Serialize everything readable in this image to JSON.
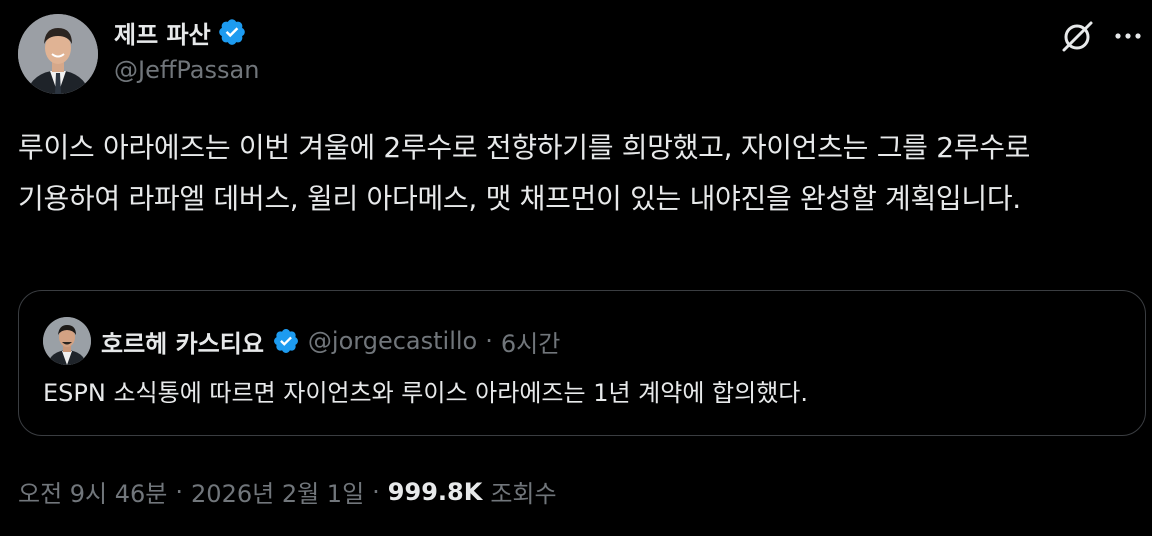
{
  "author": {
    "name": "제프 파산",
    "handle": "@JeffPassan",
    "verified": true
  },
  "tweet": {
    "text": "루이스 아라에즈는 이번 겨울에 2루수로 전향하기를 희망했고, 자이언츠는 그를 2루수로 기용하여 라파엘 데버스, 윌리 아다메스, 맷 채프먼이 있는 내야진을 완성할 계획입니다."
  },
  "quote": {
    "name": "호르헤 카스티요",
    "handle": "@jorgecastillo",
    "separator": "·",
    "time": "6시간",
    "verified": true,
    "text": "ESPN 소식통에 따르면 자이언츠와 루이스 아라에즈는 1년 계약에 합의했다."
  },
  "meta": {
    "time": "오전 9시 46분",
    "separator1": "·",
    "date": "2026년 2월 1일",
    "separator2": "·",
    "views_count": "999.8K",
    "views_label": "조회수"
  },
  "colors": {
    "background": "#000000",
    "text_primary": "#e7e9ea",
    "text_secondary": "#71767b",
    "verified_blue": "#1d9bf0",
    "border": "#3a3d41"
  },
  "icons": {
    "verified": "verified-badge-icon",
    "grok": "grok-icon",
    "more": "more-options-icon"
  }
}
